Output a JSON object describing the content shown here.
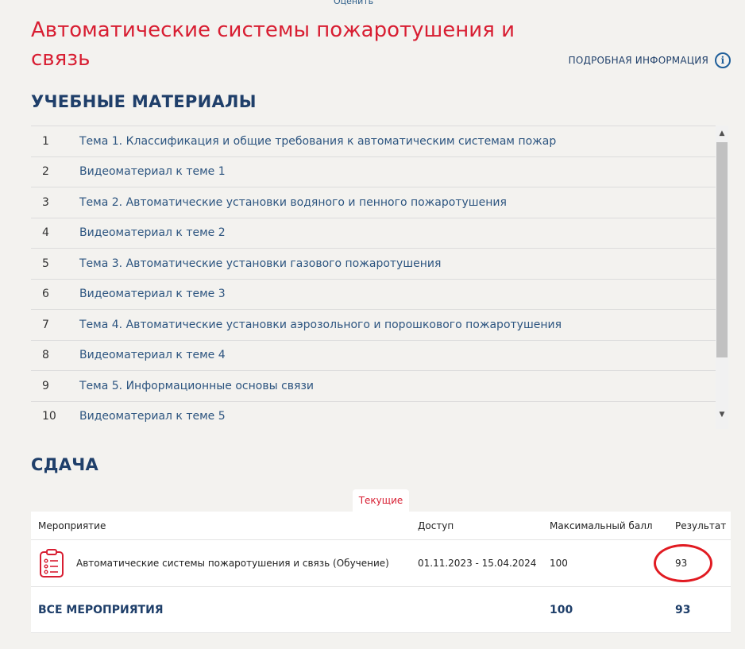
{
  "top_link": "Оценить",
  "course_title": "Автоматические системы пожаротушения и связь",
  "info_link": "ПОДРОБНАЯ ИНФОРМАЦИЯ",
  "info_icon": "info-circle-icon",
  "materials_heading": "УЧЕБНЫЕ МАТЕРИАЛЫ",
  "materials": [
    {
      "num": "1",
      "title": "Тема 1. Классификация и общие требования к автоматическим системам пожар"
    },
    {
      "num": "2",
      "title": "Видеоматериал к теме 1"
    },
    {
      "num": "3",
      "title": "Тема 2. Автоматические установки водяного и пенного пожаротушения"
    },
    {
      "num": "4",
      "title": "Видеоматериал к теме 2"
    },
    {
      "num": "5",
      "title": "Тема 3. Автоматические установки газового пожаротушения"
    },
    {
      "num": "6",
      "title": "Видеоматериал к теме 3"
    },
    {
      "num": "7",
      "title": "Тема 4. Автоматические установки аэрозольного и порошкового пожаротушения"
    },
    {
      "num": "8",
      "title": "Видеоматериал к теме 4"
    },
    {
      "num": "9",
      "title": "Тема 5. Информационные основы связи"
    },
    {
      "num": "10",
      "title": "Видеоматериал к теме 5"
    }
  ],
  "submission_heading": "СДАЧА",
  "tab_current": "Текущие",
  "table": {
    "headers": {
      "event": "Мероприятие",
      "access": "Доступ",
      "max_score": "Максимальный балл",
      "result": "Результат"
    },
    "rows": [
      {
        "icon": "clipboard-checklist-icon",
        "event": "Автоматические системы пожаротушения и связь (Обучение)",
        "access": "01.11.2023 - 15.04.2024",
        "max_score": "100",
        "result": "93"
      }
    ],
    "total": {
      "label": "ВСЕ МЕРОПРИЯТИЯ",
      "max_score": "100",
      "result": "93"
    }
  },
  "colors": {
    "title_red": "#d81e32",
    "navy": "#1f3f6a",
    "link_blue": "#2d5580",
    "annotation_red": "#e11b22",
    "background": "#f3f2ef"
  }
}
